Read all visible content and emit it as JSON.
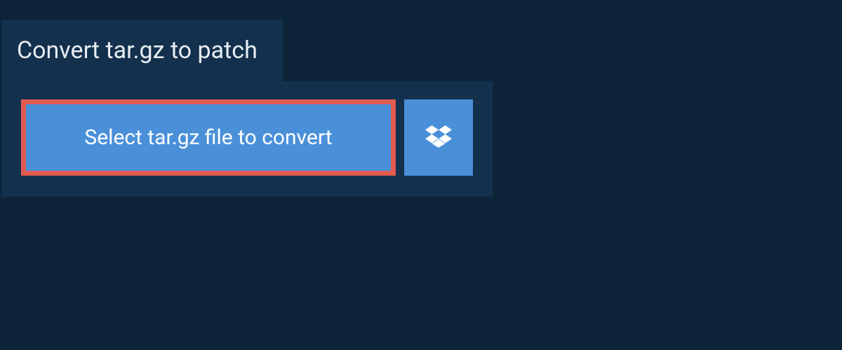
{
  "header": {
    "title": "Convert tar.gz to patch"
  },
  "upload": {
    "select_label": "Select tar.gz file to convert"
  },
  "colors": {
    "background": "#0d2438",
    "panel": "#13314d",
    "button": "#4a90d9",
    "highlight_border": "#e05a4f",
    "text_light": "#e8edf2"
  }
}
